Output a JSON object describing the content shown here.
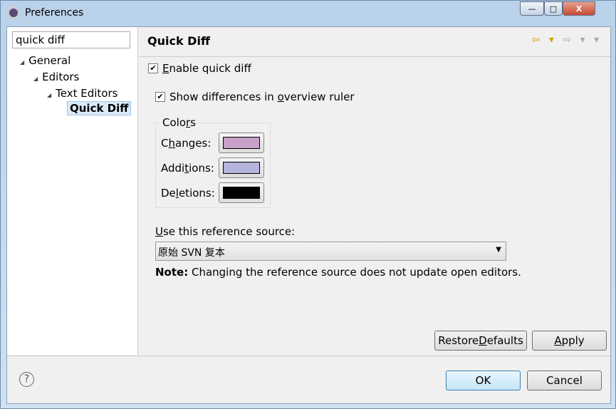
{
  "window": {
    "title": "Preferences",
    "minimize": "—",
    "maximize": "□",
    "close": "X"
  },
  "search": {
    "value": "quick diff"
  },
  "tree": [
    {
      "label": "General"
    },
    {
      "label": "Editors"
    },
    {
      "label": "Text Editors"
    },
    {
      "label": "Quick Diff"
    }
  ],
  "page": {
    "title": "Quick Diff",
    "nav_back": "⇦ ▾",
    "nav_fwd": "⇨ ▾ ▾"
  },
  "enable": {
    "pre": "",
    "mn": "E",
    "post": "nable quick diff",
    "checked": true
  },
  "overview": {
    "pre": "Show differences in ",
    "mn": "o",
    "post": "verview ruler",
    "checked": true
  },
  "colors": {
    "group": {
      "pre": "Colo",
      "mn": "r",
      "post": "s"
    },
    "changes": {
      "pre": "C",
      "mn": "h",
      "post": "anges:",
      "color": "#c8a0c8"
    },
    "additions": {
      "pre": "Addi",
      "mn": "t",
      "post": "ions:",
      "color": "#b4b4dc"
    },
    "deletions": {
      "pre": "De",
      "mn": "l",
      "post": "etions:",
      "color": "#000000"
    }
  },
  "reference": {
    "pre": "",
    "mn": "U",
    "post": "se this reference source:",
    "selected": "原始 SVN 复本"
  },
  "note": {
    "label": "Note:",
    "text": " Changing the reference source does not update open editors."
  },
  "buttons": {
    "restore": {
      "pre": "Restore ",
      "mn": "D",
      "post": "efaults"
    },
    "apply": {
      "pre": "",
      "mn": "A",
      "post": "pply"
    },
    "ok": "OK",
    "cancel": "Cancel",
    "help": "?"
  }
}
